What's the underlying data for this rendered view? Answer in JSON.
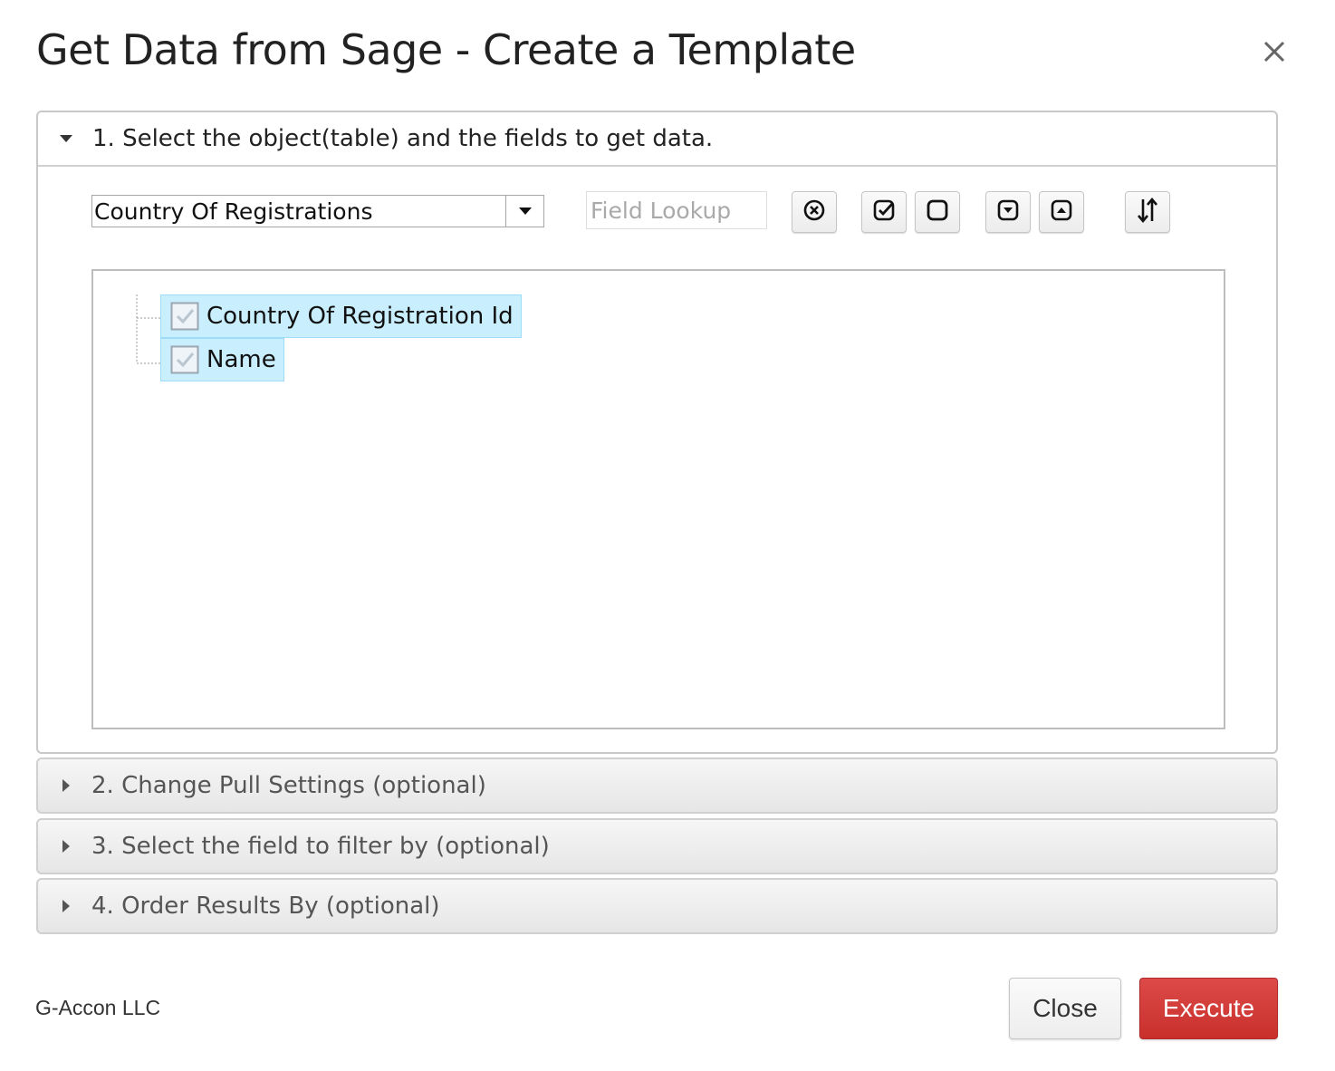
{
  "dialog": {
    "title": "Get Data from Sage - Create a Template",
    "close_icon": "close-icon"
  },
  "section1": {
    "title": "1. Select the object(table) and the fields to get data.",
    "expanded": true,
    "object_select": {
      "value": "Country Of Registrations"
    },
    "lookup": {
      "placeholder": "Field Lookup",
      "value": ""
    },
    "toolbar_icons": [
      "clear-circle-icon",
      "check-all-icon",
      "uncheck-all-icon",
      "expand-all-icon",
      "collapse-all-icon",
      "sort-icon"
    ],
    "fields": [
      {
        "label": "Country Of Registration Id",
        "checked": true
      },
      {
        "label": "Name",
        "checked": true
      }
    ]
  },
  "sections": [
    {
      "title": "2. Change Pull Settings (optional)",
      "expanded": false
    },
    {
      "title": "3. Select the field to filter by (optional)",
      "expanded": false
    },
    {
      "title": "4. Order Results By (optional)",
      "expanded": false
    }
  ],
  "footer": {
    "brand": "G-Accon LLC",
    "close_label": "Close",
    "execute_label": "Execute"
  },
  "colors": {
    "selected_item_bg": "#c9eefe",
    "execute_bg": "#d9403c"
  }
}
